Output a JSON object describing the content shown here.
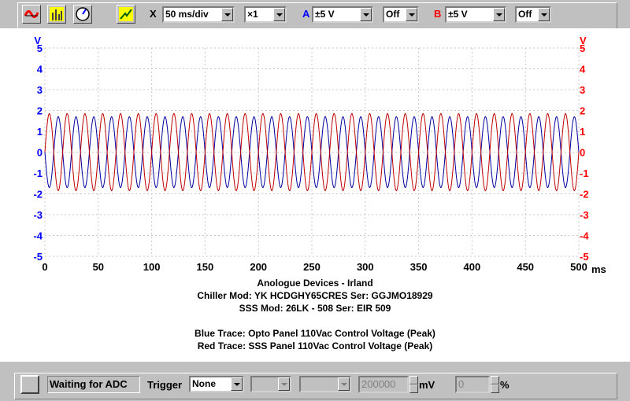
{
  "toolbar": {
    "buttons": [
      {
        "name": "scope-mode-icon"
      },
      {
        "name": "spectrum-mode-icon"
      },
      {
        "name": "meter-mode-icon"
      },
      {
        "name": "auto-setup-icon"
      }
    ],
    "x_label": "X",
    "timebase": "50 ms/div",
    "zoom": "×1",
    "channel_a_label": "A",
    "channel_a_range": "±5 V",
    "channel_a_coupling": "Off",
    "channel_b_label": "B",
    "channel_b_range": "±5 V",
    "channel_b_coupling": "Off"
  },
  "chart_data": {
    "type": "line",
    "x_unit": "ms",
    "xlim": [
      0,
      500
    ],
    "x_ticks": [
      "0",
      "50",
      "100",
      "150",
      "200",
      "250",
      "300",
      "350",
      "400",
      "450",
      "500"
    ],
    "left_axis_unit": "V",
    "right_axis_unit": "V",
    "ylim": [
      -5,
      5
    ],
    "y_ticks": [
      "5",
      "4",
      "3",
      "2",
      "1",
      "0",
      "-1",
      "-2",
      "-3",
      "-4",
      "-5"
    ],
    "grid": true,
    "series": [
      {
        "axis": "A",
        "color": "#0000a0",
        "amplitude_v": 1.7,
        "frequency_hz": 60,
        "phase_deg": 180
      },
      {
        "axis": "B",
        "color": "#c00000",
        "amplitude_v": 1.85,
        "frequency_hz": 60,
        "phase_deg": 0
      }
    ]
  },
  "caption": {
    "line1": "Anologue Devices - Irland",
    "line2": "Chiller Mod: YK HCDGHY65CRES Ser: GGJMO18929",
    "line3": "SSS Mod: 26LK - 508 Ser:  EIR 509",
    "line4": "Blue Trace: Opto Panel 110Vac Control Voltage (Peak)",
    "line5": "Red Trace: SSS Panel 110Vac Control Voltage (Peak)"
  },
  "statusbar": {
    "status": "Waiting for ADC",
    "trigger_label": "Trigger",
    "trigger_mode": "None",
    "threshold_value": "200000",
    "threshold_unit": "mV",
    "percent_value": "0",
    "percent_unit": "%"
  },
  "colors": {
    "channel_a": "#0000ff",
    "channel_b": "#ff0000",
    "trace_a": "#0000a0",
    "trace_b": "#c00000"
  }
}
